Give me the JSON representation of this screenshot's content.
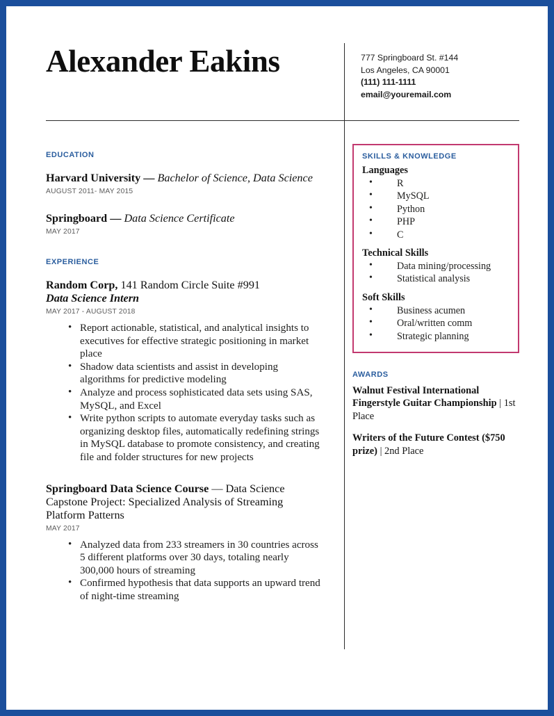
{
  "document": {
    "type": "resume",
    "page_border_color": "#1b4f9c",
    "accent_heading_color": "#2a5d9e",
    "highlight_box_color": "#c2396f"
  },
  "header": {
    "name": "Alexander Eakins",
    "contact": {
      "street": "777 Springboard St. #144",
      "city_state_zip": "Los Angeles, CA 90001",
      "phone": "(111) 111-1111",
      "email": "email@youremail.com"
    }
  },
  "left_column": {
    "education": {
      "heading": "EDUCATION",
      "entries": [
        {
          "institution": "Harvard University",
          "separator": " — ",
          "credential": "Bachelor of Science, Data Science",
          "date": "AUGUST 2011- MAY 2015"
        },
        {
          "institution": "Springboard",
          "separator": " — ",
          "credential": "Data Science Certificate",
          "date": "MAY 2017"
        }
      ]
    },
    "experience": {
      "heading": "EXPERIENCE",
      "entries": [
        {
          "employer": "Random Corp,",
          "employer_detail": " 141 Random Circle Suite #991",
          "role": "Data Science Intern",
          "date": "MAY 2017 - AUGUST 2018",
          "bullets": [
            "Report actionable, statistical, and analytical insights to executives for effective strategic positioning in market place",
            "Shadow data scientists and assist in developing algorithms for predictive modeling",
            "Analyze and process sophisticated data sets using SAS, MySQL, and Excel",
            "Write python scripts to automate everyday tasks such as organizing desktop files, automatically redefining strings in MySQL database to promote consistency, and creating file and folder structures for new projects"
          ]
        },
        {
          "employer": "Springboard Data Science Course",
          "employer_detail": " — Data Science Capstone Project: Specialized Analysis of Streaming Platform Patterns",
          "role": "",
          "date": "MAY 2017",
          "bullets": [
            "Analyzed data from 233 streamers in 30 countries across 5 different platforms over 30 days, totaling nearly 300,000 hours of streaming",
            "Confirmed hypothesis that data supports an upward trend of night-time streaming"
          ]
        }
      ]
    }
  },
  "right_column": {
    "skills": {
      "heading": "SKILLS & KNOWLEDGE",
      "groups": [
        {
          "label": "Languages",
          "items": [
            "R",
            "MySQL",
            "Python",
            "PHP",
            "C"
          ]
        },
        {
          "label": "Technical Skills",
          "items": [
            "Data mining/processing",
            "Statistical analysis"
          ]
        },
        {
          "label": "Soft Skills",
          "items": [
            "Business acumen",
            "Oral/written comm",
            "Strategic planning"
          ]
        }
      ]
    },
    "awards": {
      "heading": "AWARDS",
      "items": [
        {
          "name": "Walnut Festival International Fingerstyle Guitar Championship",
          "placement": " | 1st Place"
        },
        {
          "name": "Writers of the Future Contest ($750 prize)",
          "placement": " | 2nd Place"
        }
      ]
    }
  }
}
